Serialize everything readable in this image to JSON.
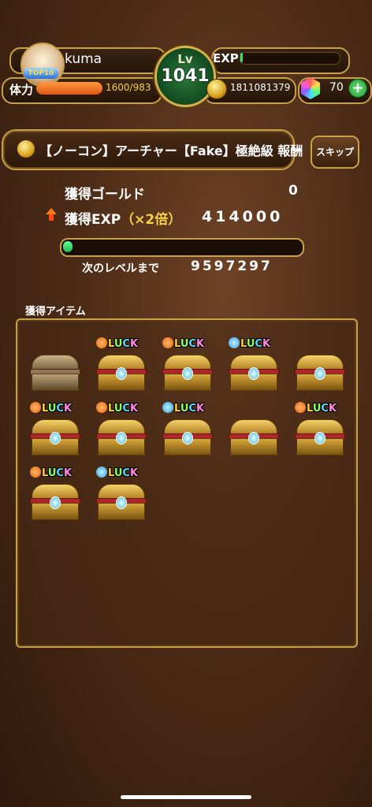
{
  "player": {
    "name": "kuma",
    "rank_badge": "TOP10",
    "level_label": "Lv",
    "level": "1041",
    "exp_label": "EXP",
    "exp_fraction": 0.02,
    "hp_label": "体力",
    "hp_text": "1600/983",
    "hp_fraction": 1.0,
    "gold": "1811081379",
    "gems": "70"
  },
  "quest": {
    "title": "【ノーコン】アーチャー【Fake】極絶級 報酬",
    "skip_label": "スキップ"
  },
  "results": {
    "gold_label": "獲得ゴールド",
    "gold_value": "0",
    "exp_label": "獲得EXP",
    "exp_multiplier": "（×2倍）",
    "exp_value": "414000",
    "next_level_label": "次のレベルまで",
    "next_level_value": "9597297",
    "next_level_fraction": 0.04
  },
  "items": {
    "title": "獲得アイテム",
    "list": [
      {
        "kind": "plain",
        "badge": ""
      },
      {
        "kind": "gold",
        "badge": "clover"
      },
      {
        "kind": "gold",
        "badge": "clover"
      },
      {
        "kind": "gold",
        "badge": "potion"
      },
      {
        "kind": "gold",
        "badge": ""
      },
      {
        "kind": "gold",
        "badge": "clover"
      },
      {
        "kind": "gold",
        "badge": "clover"
      },
      {
        "kind": "gold",
        "badge": "potion"
      },
      {
        "kind": "gold",
        "badge": ""
      },
      {
        "kind": "gold",
        "badge": "clover"
      },
      {
        "kind": "gold",
        "badge": "clover"
      },
      {
        "kind": "gold",
        "badge": "potion"
      }
    ],
    "luck_text": "LUCK"
  },
  "colors": {
    "accent_gold": "#c9a04a",
    "exp_green": "#37e06a",
    "hp_orange": "#ff9a3a",
    "multiplier_yellow": "#f6cf4b"
  }
}
